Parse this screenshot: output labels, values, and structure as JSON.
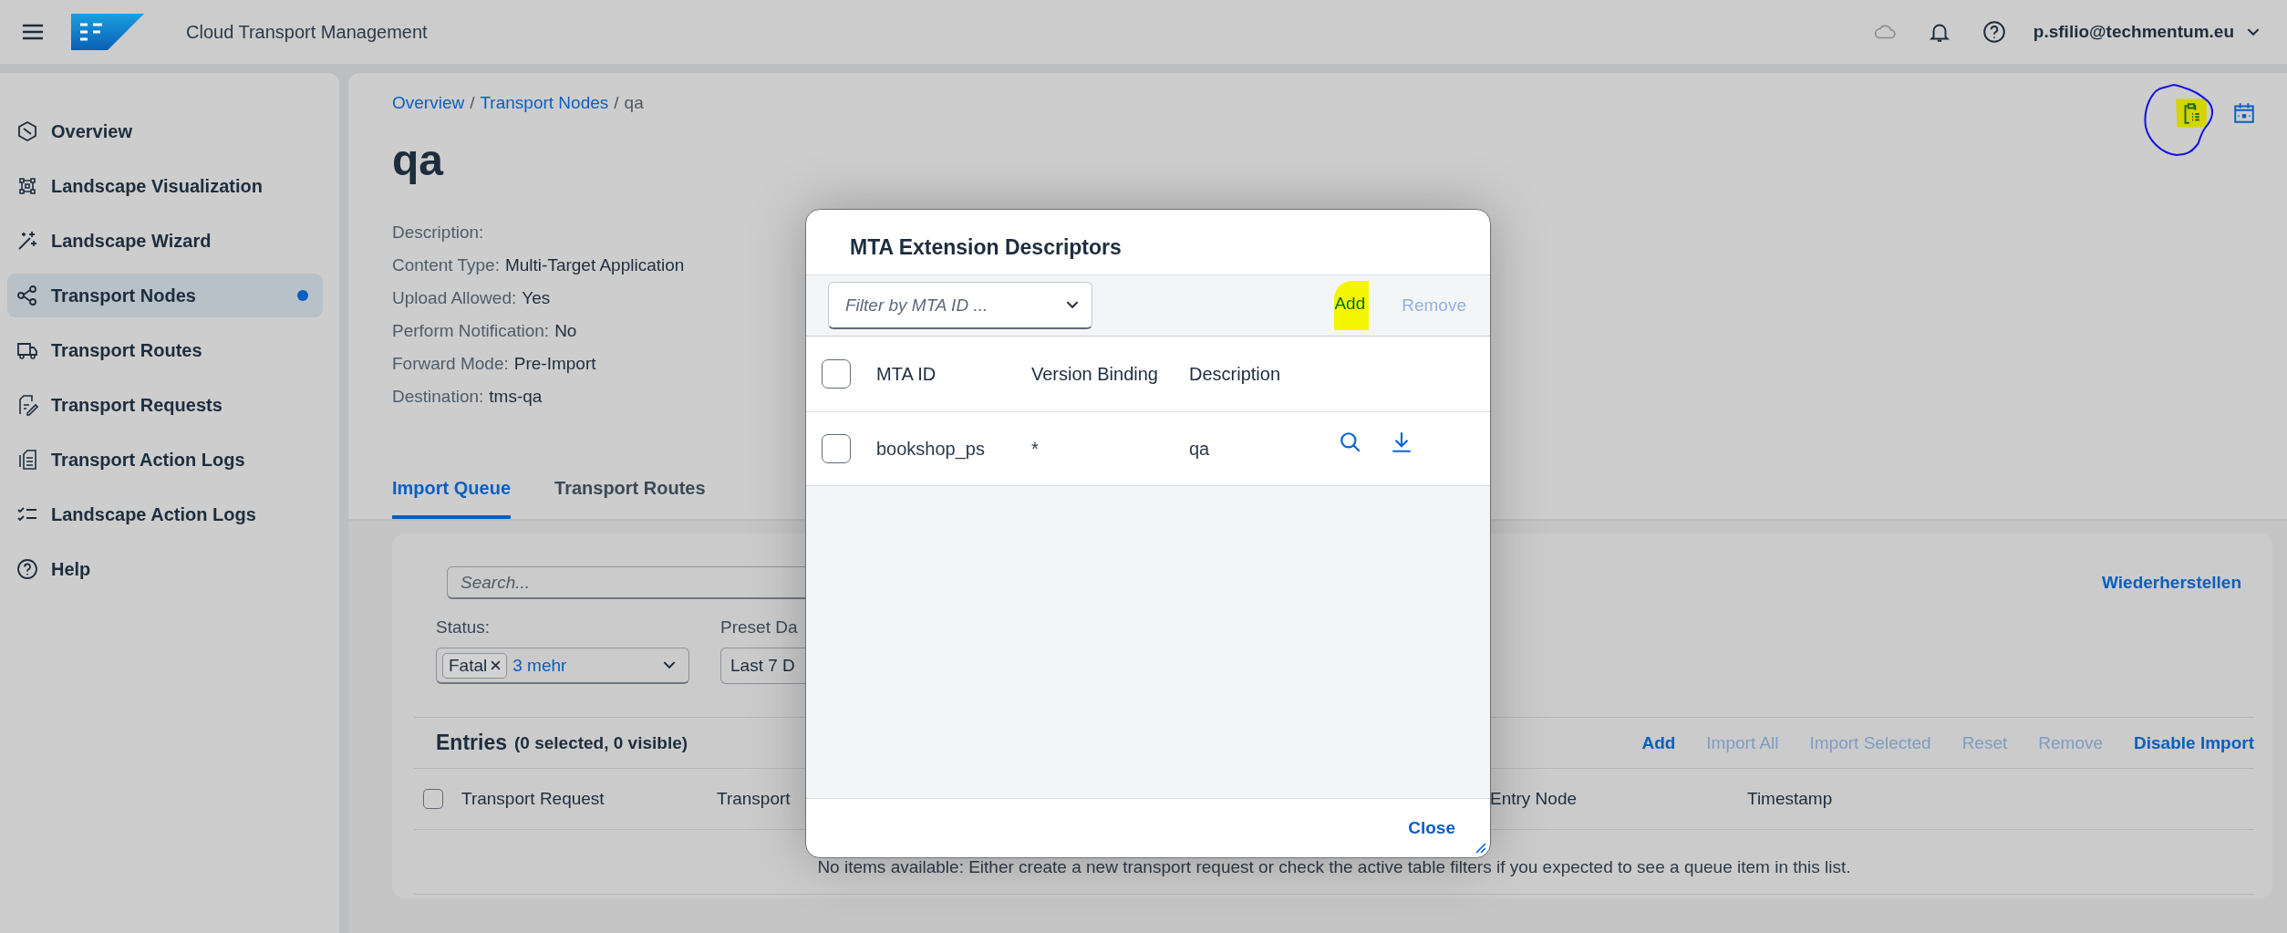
{
  "shell": {
    "app_title": "Cloud Transport Management",
    "user": "p.sfilio@techmentum.eu"
  },
  "sidebar": {
    "items": [
      {
        "label": "Overview",
        "selected": false
      },
      {
        "label": "Landscape Visualization",
        "selected": false
      },
      {
        "label": "Landscape Wizard",
        "selected": false
      },
      {
        "label": "Transport Nodes",
        "selected": true
      },
      {
        "label": "Transport Routes",
        "selected": false
      },
      {
        "label": "Transport Requests",
        "selected": false
      },
      {
        "label": "Transport Action Logs",
        "selected": false
      },
      {
        "label": "Landscape Action Logs",
        "selected": false
      },
      {
        "label": "Help",
        "selected": false
      }
    ]
  },
  "breadcrumb": {
    "links": [
      "Overview",
      "Transport Nodes"
    ],
    "current": "qa",
    "separator": "/"
  },
  "page": {
    "title": "qa",
    "attributes": [
      {
        "label": "Description:"
      },
      {
        "label": "Content Type:",
        "value": "Multi-Target Application"
      },
      {
        "label": "Upload Allowed:",
        "value": "Yes"
      },
      {
        "label": "Perform Notification:",
        "value": "No"
      },
      {
        "label": "Forward Mode:",
        "value": "Pre-Import"
      },
      {
        "label": "Destination:",
        "value": "tms-qa"
      }
    ]
  },
  "tabs": [
    {
      "label": "Import Queue",
      "selected": true
    },
    {
      "label": "Transport Routes",
      "selected": false
    }
  ],
  "filter_bar": {
    "search_placeholder": "Search...",
    "restore_link": "Wiederherstellen",
    "status": {
      "label": "Status:",
      "token": "Fatal",
      "more": "3 mehr"
    },
    "preset": {
      "label": "Preset Da",
      "value": "Last 7 D"
    }
  },
  "entries": {
    "title": "Entries",
    "count": "(0 selected, 0 visible)",
    "actions": [
      {
        "label": "Add",
        "disabled": false
      },
      {
        "label": "Import All",
        "disabled": true
      },
      {
        "label": "Import Selected",
        "disabled": true
      },
      {
        "label": "Reset",
        "disabled": true
      },
      {
        "label": "Remove",
        "disabled": true
      },
      {
        "label": "Disable Import",
        "disabled": false
      }
    ],
    "select_all_checked": false,
    "columns": [
      "Transport Request",
      "Transport",
      "Entry Node",
      "Timestamp"
    ],
    "no_data": "No items available: Either create a new transport request or check the active table filters if you expected to see a queue item in this list."
  },
  "dialog": {
    "title": "MTA Extension Descriptors",
    "filter_placeholder": "Filter by MTA ID ...",
    "actions": [
      {
        "label": "Add",
        "disabled": false
      },
      {
        "label": "Remove",
        "disabled": true
      }
    ],
    "select_all_checked": false,
    "columns": [
      "MTA ID",
      "Version Binding",
      "Description"
    ],
    "rows": [
      {
        "mta_id": "bookshop_ps",
        "version_binding": "*",
        "description": "qa",
        "checked": false
      }
    ],
    "close": "Close"
  }
}
